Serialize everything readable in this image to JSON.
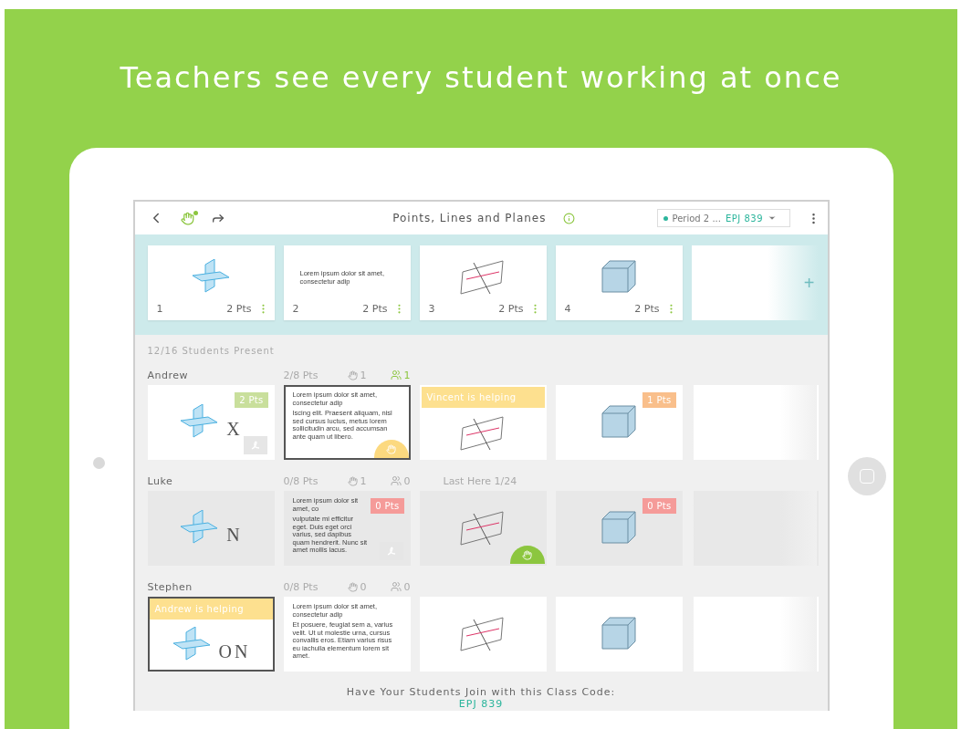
{
  "headline": "Teachers see every student working at once",
  "toolbar": {
    "title": "Points, Lines and Planes",
    "period": "Period 2 ...",
    "code": "EPJ 839"
  },
  "questions": [
    {
      "number": "1",
      "points": "2 Pts",
      "kind": "planes"
    },
    {
      "number": "2",
      "points": "2 Pts",
      "kind": "text",
      "paragraphs": [
        "Lorem ipsum dolor sit amet, consectetur adip"
      ]
    },
    {
      "number": "3",
      "points": "2 Pts",
      "kind": "lines"
    },
    {
      "number": "4",
      "points": "2 Pts",
      "kind": "cube"
    }
  ],
  "add_button": "+",
  "present": "12/16 Students Present",
  "students": [
    {
      "name": "Andrew",
      "score": "2/8 Pts",
      "hands": "1",
      "helpers": "1",
      "helping_active": true,
      "absent": false,
      "cells": [
        {
          "kind": "planes",
          "ink": "X",
          "badge": {
            "text": "2 Pts",
            "color": "#c9df9c"
          },
          "signed": true,
          "selected": false
        },
        {
          "kind": "text",
          "paragraphs": [
            "Lorem ipsum dolor sit amet, consectetur adip",
            "Iscing elit. Praesent aliquam, nisl sed cursus luctus, metus lorem sollicitudin arcu, sed accumsan ante quam ut libero."
          ],
          "hand": {
            "color": "#fcd97f"
          },
          "selected": true
        },
        {
          "kind": "lines",
          "helper": "Vincent is helping",
          "selected": false
        },
        {
          "kind": "cube",
          "badge": {
            "text": "1 Pts",
            "color": "#f9bf8b"
          },
          "selected": false
        },
        {
          "kind": "blank",
          "selected": false
        }
      ]
    },
    {
      "name": "Luke",
      "score": "0/8 Pts",
      "hands": "1",
      "helpers": "0",
      "helping_active": false,
      "absent": true,
      "last_here": "Last Here 1/24",
      "cells": [
        {
          "kind": "planes",
          "ink": "N",
          "selected": false
        },
        {
          "kind": "text",
          "paragraphs": [
            "Lorem ipsum dolor sit amet, co",
            "vulputate mi efficitur eget. Duis eget orci varius, sed dapibus quam hendrerit. Nunc sit amet mollis lacus."
          ],
          "badge": {
            "text": "0 Pts",
            "color": "#f59b99"
          },
          "signed": true,
          "selected": false
        },
        {
          "kind": "lines",
          "hand": {
            "color": "#8cc63f"
          },
          "selected": false
        },
        {
          "kind": "cube",
          "badge": {
            "text": "0 Pts",
            "color": "#f59b99"
          },
          "selected": false
        },
        {
          "kind": "blank",
          "selected": false
        }
      ]
    },
    {
      "name": "Stephen",
      "score": "0/8 Pts",
      "hands": "0",
      "helpers": "0",
      "helping_active": false,
      "absent": false,
      "cells": [
        {
          "kind": "planes",
          "ink": "ON",
          "helper": "Andrew is helping",
          "selected": true
        },
        {
          "kind": "text",
          "paragraphs": [
            "Lorem ipsum dolor sit amet, consectetur adip",
            "Et posuere, feugiat sem a, varius velit. Ut ut molestie urna, cursus convallis eros. Etiam varius risus eu iachulla elementum lorem sit amet."
          ],
          "selected": false
        },
        {
          "kind": "lines",
          "selected": false
        },
        {
          "kind": "cube",
          "selected": false
        },
        {
          "kind": "blank",
          "selected": false
        }
      ]
    }
  ],
  "footer": {
    "prompt": "Have Your Students Join with this Class Code:",
    "code": "EPJ 839"
  }
}
